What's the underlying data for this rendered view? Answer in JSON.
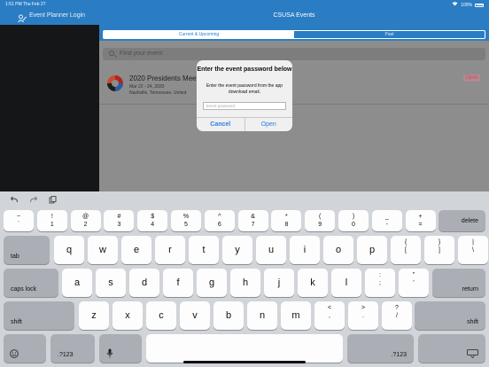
{
  "status_bar": {
    "time_date": "1:51 PM   Thu Feb 27",
    "battery": "100%"
  },
  "sidebar": {
    "title": "Event Planner Login"
  },
  "header": {
    "title": "CSUSA Events",
    "tabs": [
      "Current & Upcoming",
      "Past"
    ],
    "active_tab": 0
  },
  "search": {
    "placeholder": "Find your event"
  },
  "events": [
    {
      "name": "2020 Presidents Meeti",
      "dates": "Mar 22 - 24, 2020",
      "location": "Nashville, Tennessee, United",
      "status": "Open"
    }
  ],
  "dialog": {
    "title": "Enter the event password below",
    "message": "Enter the event password from the app download email.",
    "input_placeholder": "Event password",
    "cancel": "Cancel",
    "confirm": "Open"
  },
  "keyboard": {
    "toolbar": [
      "undo-icon",
      "redo-icon",
      "paste-icon"
    ],
    "row1": [
      {
        "top": "~",
        "bot": "`"
      },
      {
        "top": "!",
        "bot": "1"
      },
      {
        "top": "@",
        "bot": "2"
      },
      {
        "top": "#",
        "bot": "3"
      },
      {
        "top": "$",
        "bot": "4"
      },
      {
        "top": "%",
        "bot": "5"
      },
      {
        "top": "^",
        "bot": "6"
      },
      {
        "top": "&",
        "bot": "7"
      },
      {
        "top": "*",
        "bot": "8"
      },
      {
        "top": "(",
        "bot": "9"
      },
      {
        "top": ")",
        "bot": "0"
      },
      {
        "top": "_",
        "bot": "-"
      },
      {
        "top": "+",
        "bot": "="
      }
    ],
    "delete": "delete",
    "tab": "tab",
    "row2": [
      "q",
      "w",
      "e",
      "r",
      "t",
      "y",
      "u",
      "i",
      "o",
      "p"
    ],
    "row2_sym": [
      {
        "top": "{",
        "bot": "["
      },
      {
        "top": "}",
        "bot": "]"
      },
      {
        "top": "|",
        "bot": "\\"
      }
    ],
    "caps": "caps lock",
    "row3": [
      "a",
      "s",
      "d",
      "f",
      "g",
      "h",
      "j",
      "k",
      "l"
    ],
    "row3_sym": [
      {
        "top": ":",
        "bot": ";"
      },
      {
        "top": "\"",
        "bot": "'"
      }
    ],
    "return": "return",
    "shift": "shift",
    "row4": [
      "z",
      "x",
      "c",
      "v",
      "b",
      "n",
      "m"
    ],
    "row4_sym": [
      {
        "top": "<",
        "bot": ","
      },
      {
        "top": ">",
        "bot": "."
      },
      {
        "top": "?",
        "bot": "/"
      }
    ],
    "numbers": ".?123",
    "emoji_icon": "emoji-icon",
    "mic_icon": "mic-icon",
    "dismiss_icon": "keyboard-dismiss-icon"
  }
}
